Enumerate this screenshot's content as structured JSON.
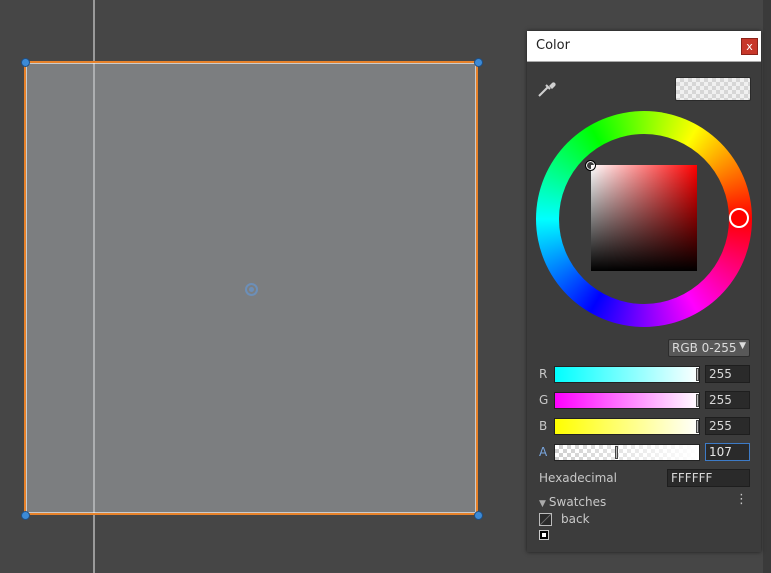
{
  "window": {
    "title": "Color",
    "close_label": "x"
  },
  "preview": {
    "hex": "FFFFFF",
    "alpha": 107
  },
  "picker": {
    "hue_color": "#ff0000"
  },
  "mode": {
    "selected": "RGB 0-255",
    "arrow": "▼"
  },
  "channels": [
    {
      "label": "R",
      "value": "255"
    },
    {
      "label": "G",
      "value": "255"
    },
    {
      "label": "B",
      "value": "255"
    },
    {
      "label": "A",
      "value": "107"
    }
  ],
  "hex": {
    "label": "Hexadecimal",
    "value": "FFFFFF"
  },
  "swatches": {
    "label": "Swatches",
    "toggle_glyph": "▼",
    "menu_glyph": "⋮",
    "items": [
      {
        "name": "back"
      }
    ]
  },
  "colors": {
    "selection_outline": "#e7822a",
    "handle": "#3c8ad6",
    "focus": "#3d7bc7"
  }
}
